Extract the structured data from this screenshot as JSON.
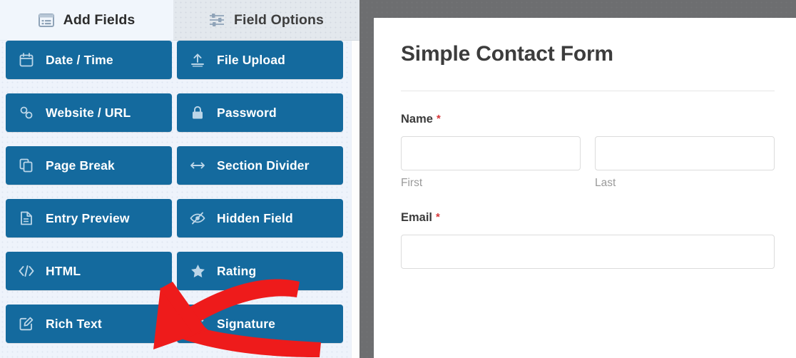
{
  "app": {
    "accent_blue": "#146a9e",
    "panel_bg": "#eef3fb",
    "preview_bg": "#6d6e70",
    "annotation_color": "#ee1b1b"
  },
  "tabs": [
    {
      "id": "add-fields",
      "label": "Add Fields",
      "icon": "list-window-icon",
      "active": true
    },
    {
      "id": "field-options",
      "label": "Field Options",
      "icon": "sliders-icon",
      "active": false
    }
  ],
  "fields_panel": {
    "left_column": [
      {
        "label": "Date / Time",
        "icon": "calendar-icon"
      },
      {
        "label": "Website / URL",
        "icon": "link-icon"
      },
      {
        "label": "Page Break",
        "icon": "page-break-icon"
      },
      {
        "label": "Entry Preview",
        "icon": "document-icon"
      },
      {
        "label": "HTML",
        "icon": "code-icon"
      },
      {
        "label": "Rich Text",
        "icon": "rich-text-icon"
      }
    ],
    "right_column": [
      {
        "label": "File Upload",
        "icon": "upload-icon"
      },
      {
        "label": "Password",
        "icon": "lock-icon"
      },
      {
        "label": "Section Divider",
        "icon": "arrows-horizontal-icon"
      },
      {
        "label": "Hidden Field",
        "icon": "eye-slash-icon"
      },
      {
        "label": "Rating",
        "icon": "star-icon"
      },
      {
        "label": "Signature",
        "icon": "pencil-icon"
      }
    ]
  },
  "form_preview": {
    "title": "Simple Contact Form",
    "fields": [
      {
        "label": "Name",
        "required_marker": "*",
        "type": "name",
        "inputs": [
          {
            "value": "",
            "placeholder": "",
            "sublabel": "First"
          },
          {
            "value": "",
            "placeholder": "",
            "sublabel": "Last"
          }
        ]
      },
      {
        "label": "Email",
        "required_marker": "*",
        "type": "email",
        "inputs": [
          {
            "value": "",
            "placeholder": "",
            "sublabel": ""
          }
        ]
      }
    ]
  },
  "annotation": {
    "type": "arrow",
    "points_to": "Rich Text",
    "color": "#ee1b1b"
  }
}
